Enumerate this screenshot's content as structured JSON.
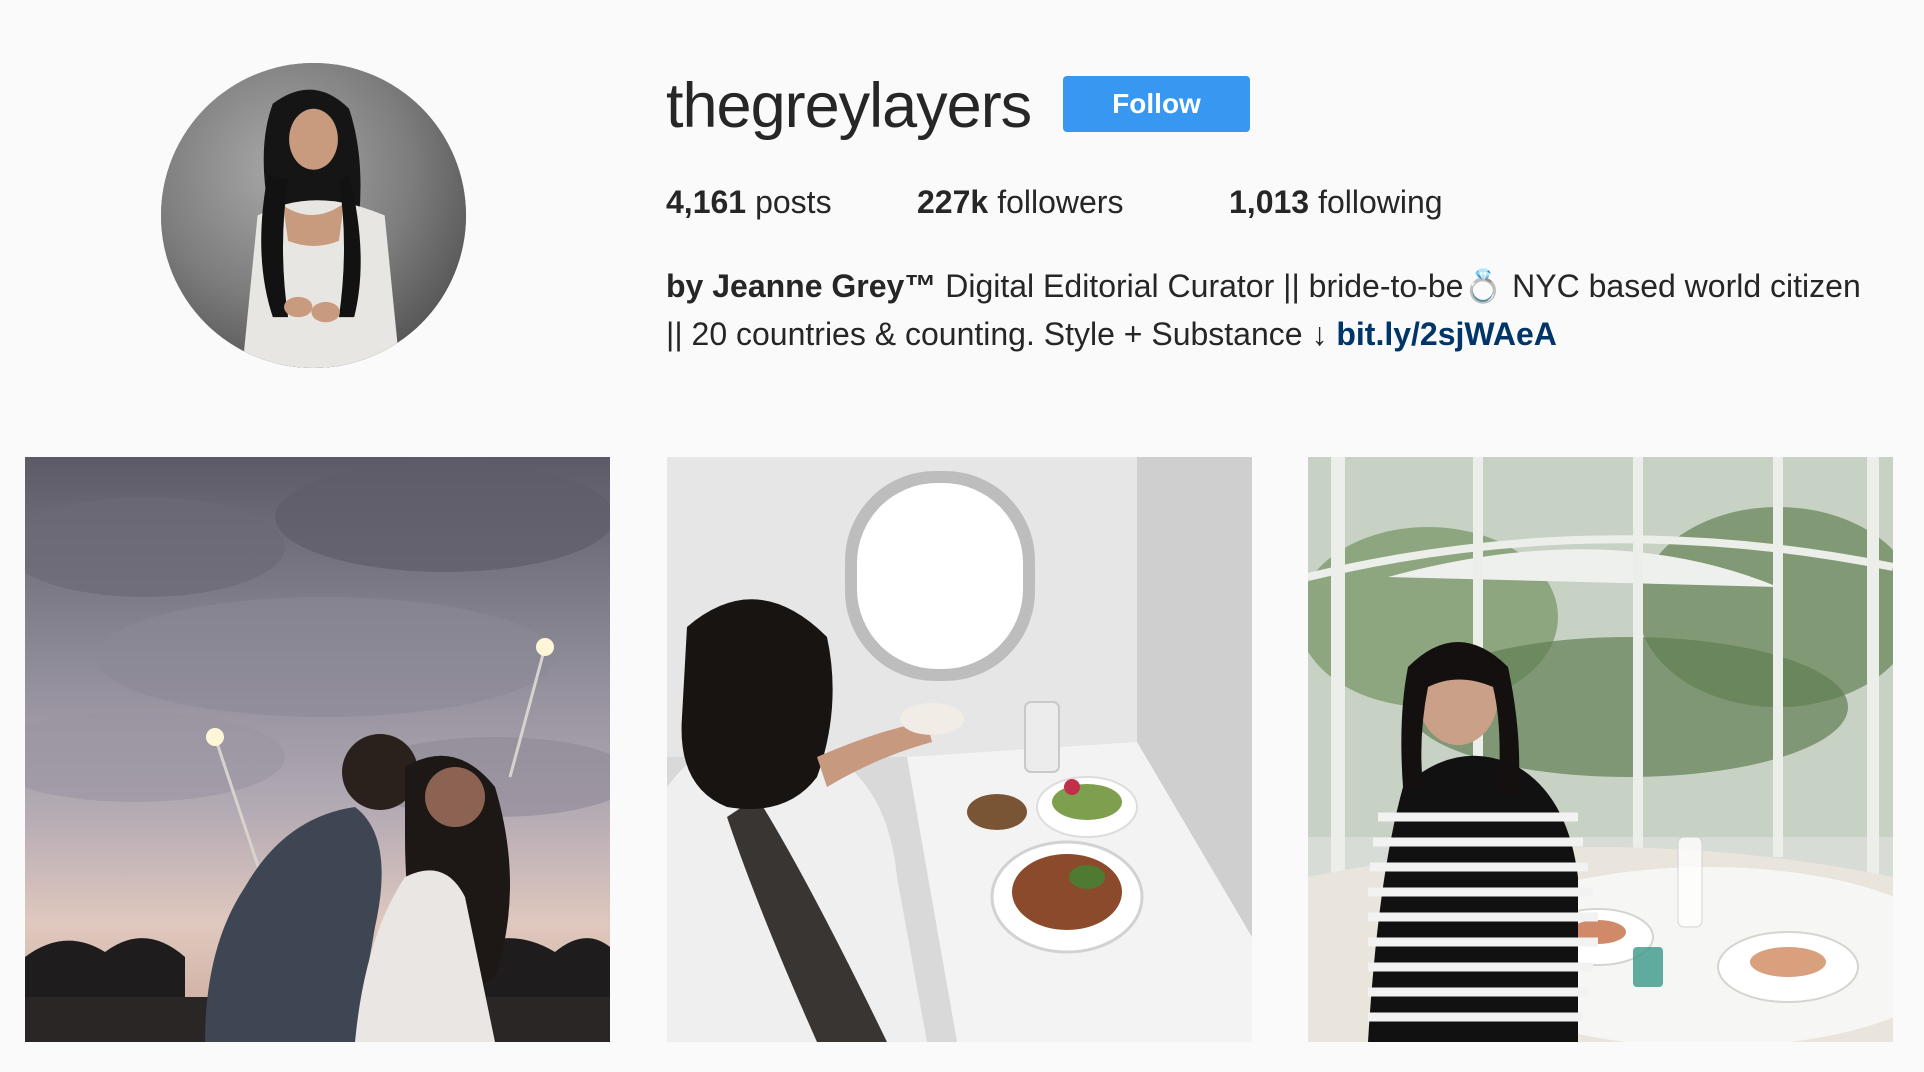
{
  "profile": {
    "username": "thegreylayers",
    "follow_label": "Follow",
    "avatar_alt": "profile-photo"
  },
  "stats": {
    "posts_count": "4,161",
    "posts_label": "posts",
    "followers_count": "227k",
    "followers_label": "followers",
    "following_count": "1,013",
    "following_label": "following"
  },
  "bio": {
    "name": "by Jeanne Grey™",
    "line1_text": " Digital Editorial Curator || bride-to-be💍 NYC based world citizen",
    "line2_text": "|| 20 countries & counting. Style + Substance ↓ ",
    "link": "bit.ly/2sjWAeA"
  },
  "posts": [
    {
      "subject": "couple-with-sparklers-at-sunset"
    },
    {
      "subject": "woman-eating-meal-on-airplane"
    },
    {
      "subject": "woman-dining-in-glass-restaurant"
    }
  ],
  "colors": {
    "background": "#fafafa",
    "follow_button": "#3897f0",
    "link": "#003569",
    "text": "#262626"
  }
}
